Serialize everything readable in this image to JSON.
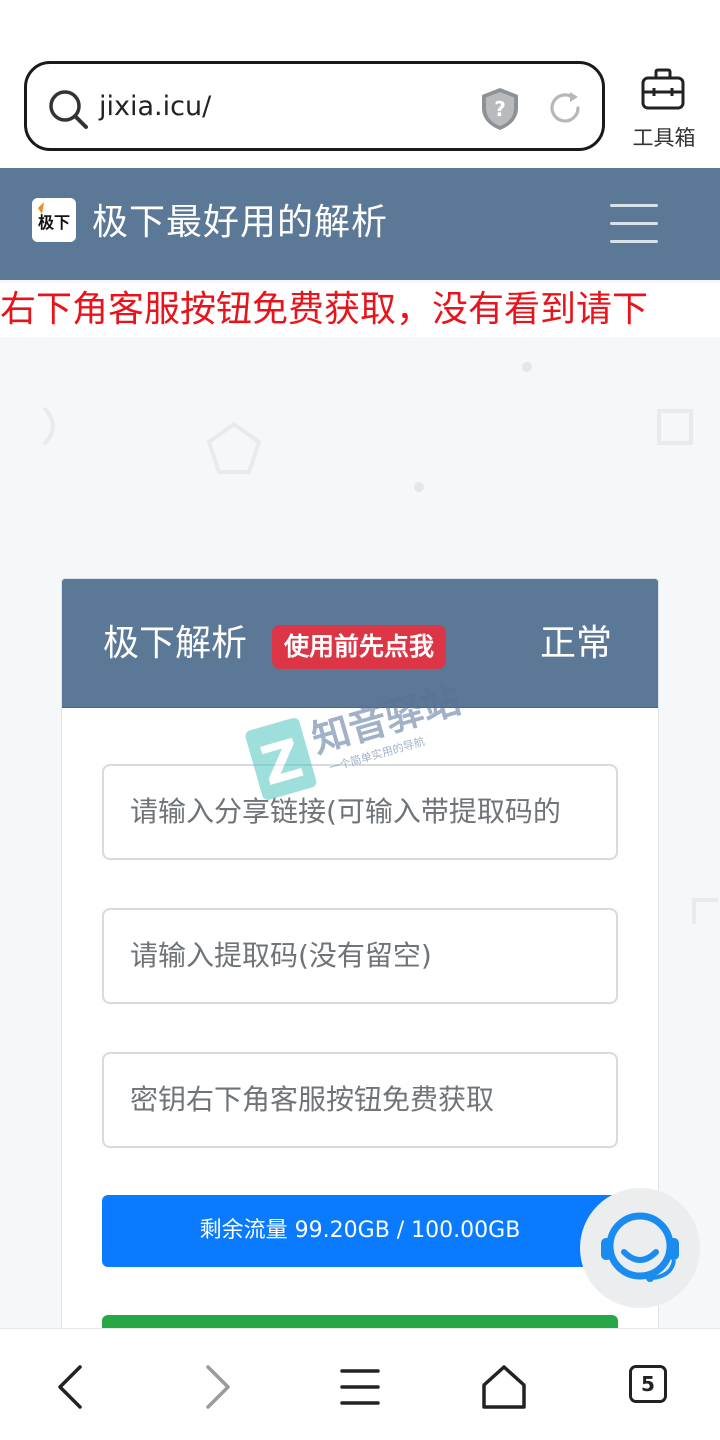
{
  "browser": {
    "url": "jixia.icu/",
    "toolbox_label": "工具箱",
    "tab_count": "5"
  },
  "site": {
    "logo_text": "极下",
    "title": "极下最好用的解析"
  },
  "notice": {
    "text": "右下角客服按钮免费获取，没有看到请下"
  },
  "card": {
    "title": "极下解析",
    "badge": "使用前先点我",
    "status": "正常",
    "fields": [
      {
        "placeholder": "请输入分享链接(可输入带提取码的"
      },
      {
        "placeholder": "请输入提取码(没有留空)"
      },
      {
        "placeholder": "密钥右下角客服按钮免费获取"
      }
    ],
    "traffic": {
      "text": "剩余流量 99.20GB / 100.00GB",
      "used_fraction": 0.008
    }
  },
  "watermark": {
    "name": "知音驿站",
    "slogan": "一个简单实用的导航"
  },
  "colors": {
    "header_bg": "#5b7897",
    "notice_red": "#e8141b",
    "badge_red": "#dc3545",
    "traffic_blue": "#0a7bff",
    "submit_green": "#28a745"
  },
  "icons": {
    "url_search": "search-icon",
    "security": "shield-icon",
    "reload": "reload-icon",
    "toolbox": "toolbox-icon",
    "menu": "hamburger-menu-icon",
    "support": "customer-service-icon",
    "back": "chevron-left-icon",
    "forward": "chevron-right-icon",
    "menu_nav": "menu-lines-icon",
    "home": "home-icon"
  }
}
